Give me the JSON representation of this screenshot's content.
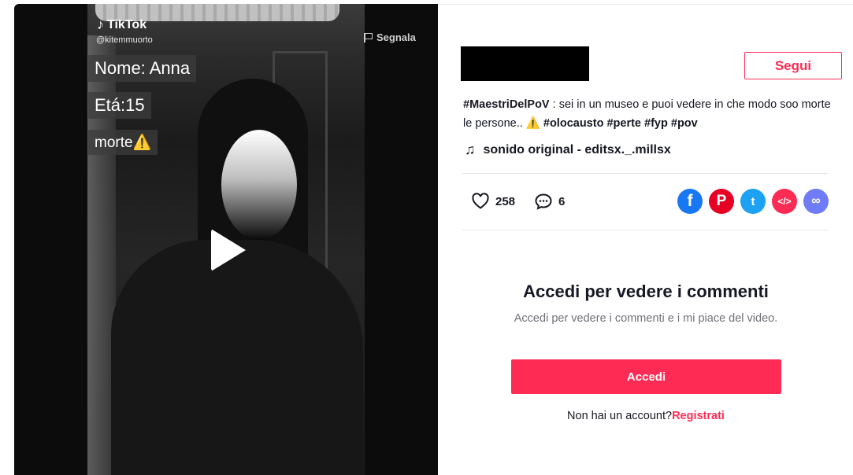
{
  "video": {
    "brand": "TikTok",
    "handle": "@kitemmuorto",
    "report_label": "Segnala",
    "captions": [
      "Nome: Anna",
      "Etá:15",
      "morte⚠️"
    ]
  },
  "header": {
    "follow_label": "Segui"
  },
  "description": {
    "lead_tag": "#MaestriDelPoV",
    "text": " : sei in un museo e puoi vedere in che modo soo morte le persone.. ⚠️ ",
    "tags": [
      "#olocausto",
      "#perte",
      "#fyp",
      "#pov"
    ]
  },
  "music": {
    "icon": "music-note-icon",
    "label": "sonido original - editsx._.millsx"
  },
  "stats": {
    "likes": "258",
    "comments": "6"
  },
  "share": {
    "icons": [
      "facebook-icon",
      "pinterest-icon",
      "twitter-icon",
      "embed-icon",
      "link-icon"
    ],
    "glyphs": [
      "f",
      "P",
      "t",
      "</>",
      "∞"
    ]
  },
  "login_prompt": {
    "title": "Accedi per vedere i commenti",
    "subtitle": "Accedi per vedere i commenti e i mi piace del video.",
    "button": "Accedi",
    "signup_text": "Non hai un account?",
    "signup_link": "Registrati"
  },
  "colors": {
    "accent": "#fe2c55",
    "facebook": "#1877f2",
    "pinterest": "#e60023",
    "twitter": "#1da1f2",
    "link": "#6f7bf7"
  }
}
